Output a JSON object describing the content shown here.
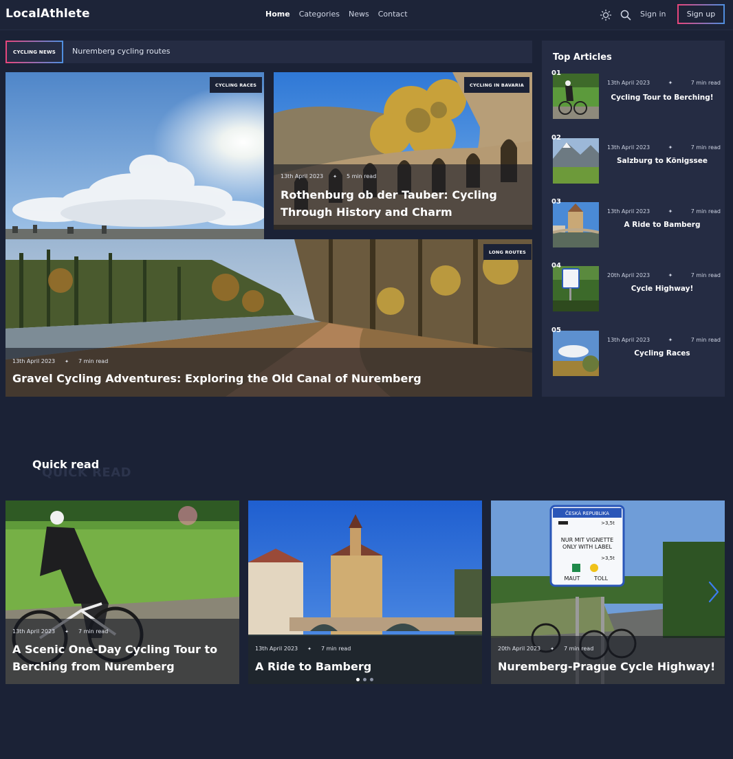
{
  "header": {
    "logo": "LocalAthlete",
    "nav": [
      {
        "label": "Home",
        "active": true
      },
      {
        "label": "Categories",
        "active": false
      },
      {
        "label": "News",
        "active": false
      },
      {
        "label": "Contact",
        "active": false
      }
    ],
    "icons": [
      "sun-icon",
      "search-icon"
    ],
    "signin": "Sign in",
    "signup": "Sign up"
  },
  "ticker": {
    "badge": "CYCLING NEWS",
    "text": "Nuremberg cycling routes"
  },
  "hero": {
    "card1": {
      "badge": "CYCLING RACES"
    },
    "card2": {
      "badge": "CYCLING IN BAVARIA",
      "date": "13th April 2023",
      "read": "5 min read",
      "title": "Rothenburg ob der Tauber: Cycling Through History and Charm"
    },
    "card3": {
      "badge": "LONG ROUTES",
      "date": "13th April 2023",
      "read": "7 min read",
      "title": "Gravel Cycling Adventures: Exploring the Old Canal of Nuremberg"
    }
  },
  "sidebar": {
    "title": "Top Articles",
    "articles": [
      {
        "num": "01",
        "date": "13th April 2023",
        "read": "7 min read",
        "title": "Cycling Tour to Berching!"
      },
      {
        "num": "02",
        "date": "13th April 2023",
        "read": "7 min read",
        "title": "Salzburg to Königssee"
      },
      {
        "num": "03",
        "date": "13th April 2023",
        "read": "7 min read",
        "title": "A Ride to Bamberg"
      },
      {
        "num": "04",
        "date": "20th April 2023",
        "read": "7 min read",
        "title": "Cycle Highway!"
      },
      {
        "num": "05",
        "date": "13th April 2023",
        "read": "7 min read",
        "title": "Cycling Races"
      }
    ]
  },
  "quick": {
    "bg": "QUICK READ",
    "title": "Quick read",
    "cards": [
      {
        "date": "13th April 2023",
        "read": "7 min read",
        "title": "A Scenic One-Day Cycling Tour to Berching from Nuremberg"
      },
      {
        "date": "13th April 2023",
        "read": "7 min read",
        "title": "A Ride to Bamberg"
      },
      {
        "date": "20th April 2023",
        "read": "7 min read",
        "title": "Nuremberg-Prague Cycle Highway!"
      }
    ],
    "sign": {
      "country": "ČESKÁ REPUBLIKA",
      "weight1": ">3,5t",
      "line1": "NUR MIT VIGNETTE",
      "line2": "ONLY WITH LABEL",
      "weight2": ">3,5t",
      "maut": "MAUT",
      "toll": "TOLL"
    }
  },
  "colors": {
    "bg": "#1b2236",
    "panel": "#252c43",
    "accent_pink": "#e8467c",
    "accent_blue": "#4f8fe0"
  }
}
